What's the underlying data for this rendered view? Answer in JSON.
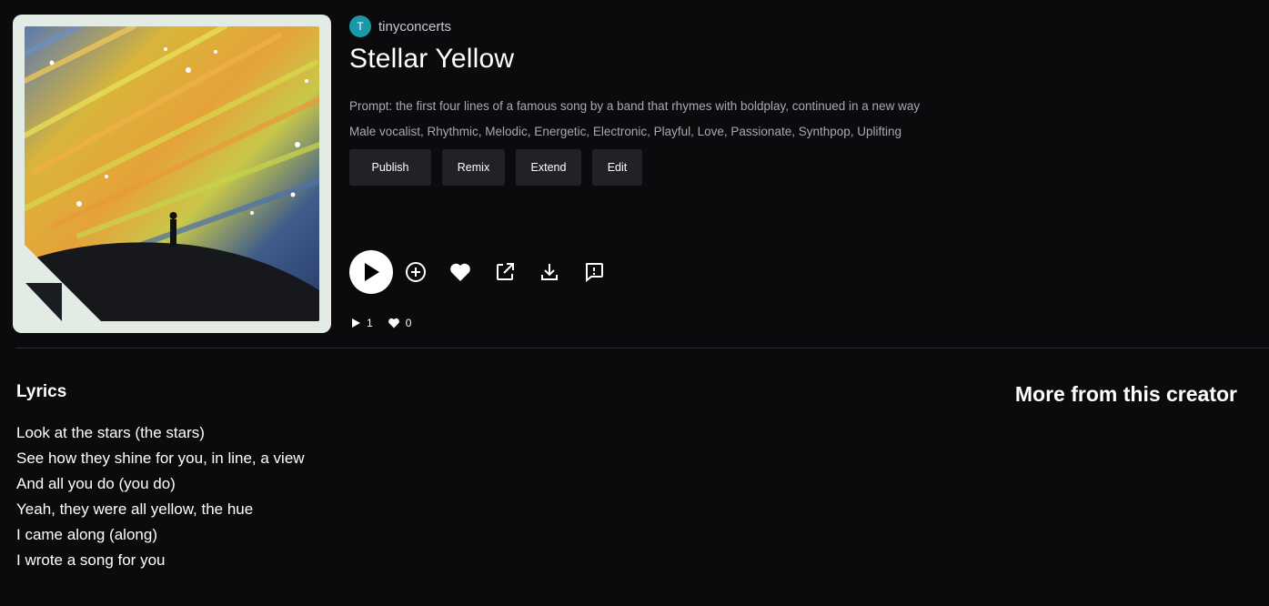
{
  "song": {
    "creator_initial": "T",
    "creator_name": "tinyconcerts",
    "title": "Stellar Yellow",
    "prompt": "Prompt: the first four lines of a famous song by a band that rhymes with boldplay, continued in a new way",
    "tags": "Male vocalist, Rhythmic, Melodic, Energetic, Electronic, Playful, Love, Passionate, Synthpop, Uplifting"
  },
  "actions": {
    "publish": "Publish",
    "remix": "Remix",
    "extend": "Extend",
    "edit": "Edit"
  },
  "stats": {
    "plays": "1",
    "likes": "0"
  },
  "lyrics": {
    "heading": "Lyrics",
    "lines": [
      "Look at the stars (the stars)",
      "See how they shine for you, in line, a view",
      "And all you do (you do)",
      "Yeah, they were all yellow, the hue",
      "I came along (along)",
      "I wrote a song for you"
    ]
  },
  "sidebar": {
    "heading": "More from this creator"
  },
  "icons": {
    "play": "play-icon",
    "add": "plus-circle-icon",
    "like": "heart-icon",
    "share": "external-link-icon",
    "download": "download-icon",
    "report": "comment-alert-icon"
  },
  "colors": {
    "background": "#0b0a0d",
    "avatar": "#1a9aa8",
    "button_bg": "#222226"
  }
}
